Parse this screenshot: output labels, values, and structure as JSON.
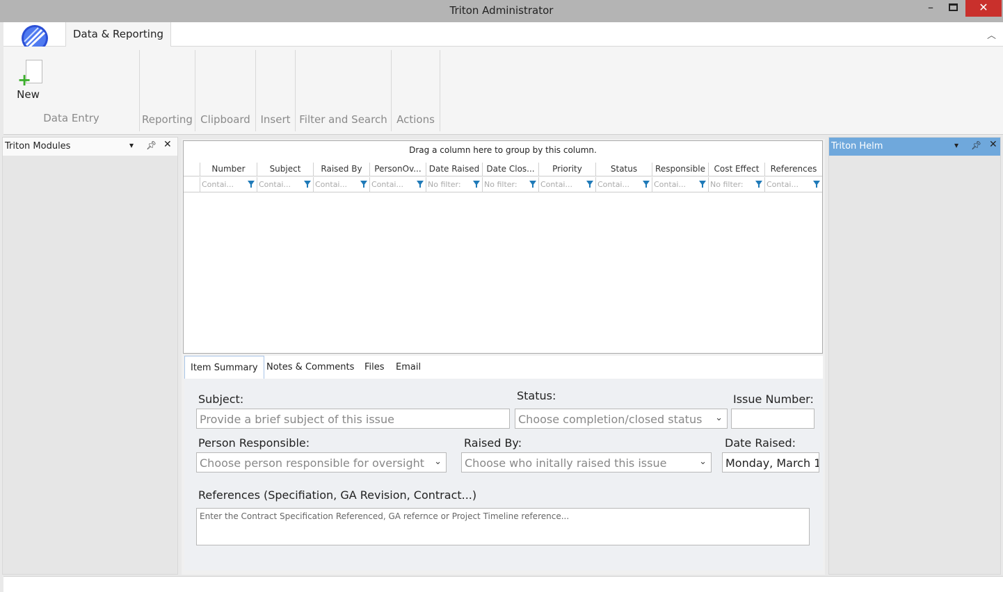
{
  "window": {
    "title": "Triton Administrator",
    "minimize": "–",
    "close": "✕"
  },
  "ribbon": {
    "tab": "Data & Reporting",
    "collapse_icon": "chevron-up",
    "new_button": "New",
    "groups": [
      "Data Entry",
      "Reporting",
      "Clipboard",
      "Insert",
      "Filter and Search",
      "Actions"
    ]
  },
  "left_panel": {
    "title": "Triton Modules"
  },
  "right_panel": {
    "title": "Triton Helm",
    "accent": "#6fa8dc"
  },
  "grid": {
    "group_hint": "Drag a column here to group by this column.",
    "columns": [
      "Number",
      "Subject",
      "Raised By",
      "PersonOv...",
      "Date Raised",
      "Date Clos...",
      "Priority",
      "Status",
      "Responsible",
      "Cost Effect",
      "References"
    ],
    "filters": [
      "Contai...",
      "Contai...",
      "Contai...",
      "Contai...",
      "No filter:",
      "No filter:",
      "Contai...",
      "Contai...",
      "Contai...",
      "No filter:",
      "Contai..."
    ]
  },
  "detail_tabs": [
    "Item Summary",
    "Notes & Comments",
    "Files",
    "Email"
  ],
  "form": {
    "subject_label": "Subject:",
    "subject_placeholder": "Provide a brief subject of this issue",
    "status_label": "Status:",
    "status_placeholder": "Choose completion/closed status",
    "issue_number_label": "Issue Number:",
    "issue_number_value": "",
    "person_label": "Person Responsible:",
    "person_placeholder": "Choose person responsible for oversight",
    "raised_by_label": "Raised By:",
    "raised_by_placeholder": "Choose who initally raised this issue",
    "date_raised_label": "Date Raised:",
    "date_raised_value": "Monday, March 1",
    "references_label": "References (Specifiation, GA Revision, Contract...)",
    "references_placeholder": "Enter the Contract Specification Referenced, GA refernce or Project Timeline reference..."
  }
}
